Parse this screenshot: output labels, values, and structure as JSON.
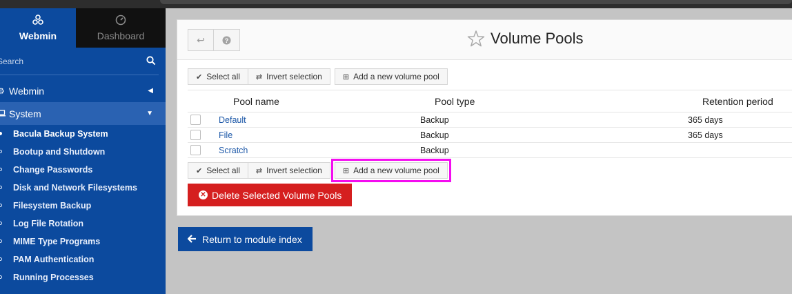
{
  "sidebar": {
    "tabs": [
      {
        "label": "Webmin",
        "icon": "webmin-logo-icon"
      },
      {
        "label": "Dashboard",
        "icon": "dashboard-gauge-icon"
      }
    ],
    "search_placeholder": "Search",
    "menu": [
      {
        "label": "Webmin",
        "icon": "gear-icon",
        "expanded": false
      },
      {
        "label": "System",
        "icon": "laptop-icon",
        "expanded": true
      }
    ],
    "sub_items": [
      "Bacula Backup System",
      "Bootup and Shutdown",
      "Change Passwords",
      "Disk and Network Filesystems",
      "Filesystem Backup",
      "Log File Rotation",
      "MIME Type Programs",
      "PAM Authentication",
      "Running Processes"
    ]
  },
  "page": {
    "title": "Volume Pools",
    "back_icon": "return-arrow-icon",
    "help_icon": "help-icon"
  },
  "toolbar": {
    "select_all": "Select all",
    "invert_selection": "Invert selection",
    "add_pool": "Add a new volume pool"
  },
  "table": {
    "headers": [
      "Pool name",
      "Pool type",
      "Retention period"
    ],
    "rows": [
      {
        "name": "Default",
        "type": "Backup",
        "retention": "365 days"
      },
      {
        "name": "File",
        "type": "Backup",
        "retention": "365 days"
      },
      {
        "name": "Scratch",
        "type": "Backup",
        "retention": ""
      }
    ]
  },
  "actions": {
    "delete": "Delete Selected Volume Pools",
    "return": "Return to module index"
  },
  "colors": {
    "sidebar": "#0c4a9e",
    "delete": "#d51f1f",
    "highlight": "#f40cf0",
    "link": "#1d58a8"
  }
}
